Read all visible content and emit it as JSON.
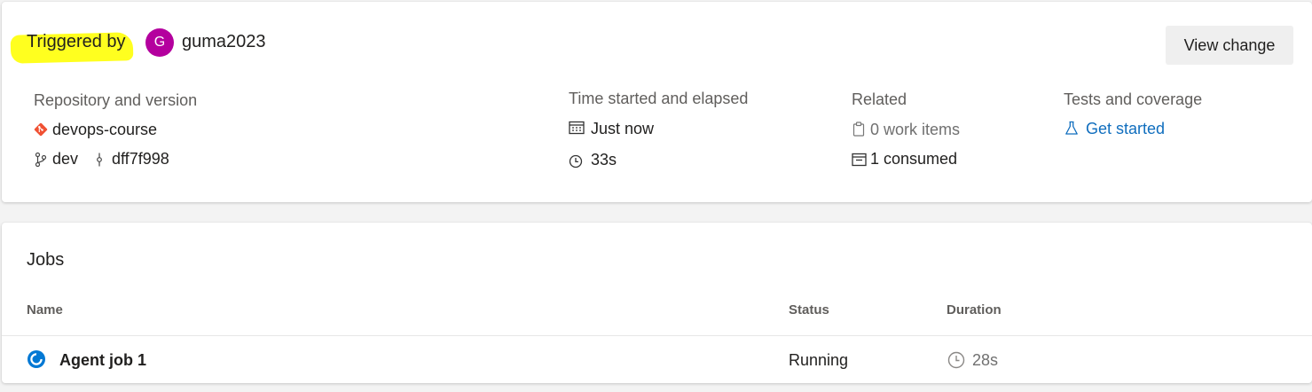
{
  "summary": {
    "triggered_label": "Triggered by",
    "avatar_initial": "G",
    "avatar_color": "#b4009e",
    "username": "guma2023",
    "view_change_label": "View change",
    "repository": {
      "label": "Repository and version",
      "name": "devops-course",
      "branch": "dev",
      "commit": "dff7f998"
    },
    "time": {
      "label": "Time started and elapsed",
      "started": "Just now",
      "elapsed": "33s"
    },
    "related": {
      "label": "Related",
      "work_items": "0 work items",
      "consumed": "1 consumed"
    },
    "tests": {
      "label": "Tests and coverage",
      "get_started": "Get started"
    }
  },
  "jobs": {
    "title": "Jobs",
    "columns": {
      "name": "Name",
      "status": "Status",
      "duration": "Duration"
    },
    "rows": [
      {
        "name": "Agent job 1",
        "status": "Running",
        "duration": "28s",
        "status_color": "#0078d4"
      }
    ]
  },
  "colors": {
    "highlight": "#ffff1f",
    "git_orange": "#f05133",
    "link_blue": "#106ebe",
    "running_blue": "#0078d4"
  }
}
